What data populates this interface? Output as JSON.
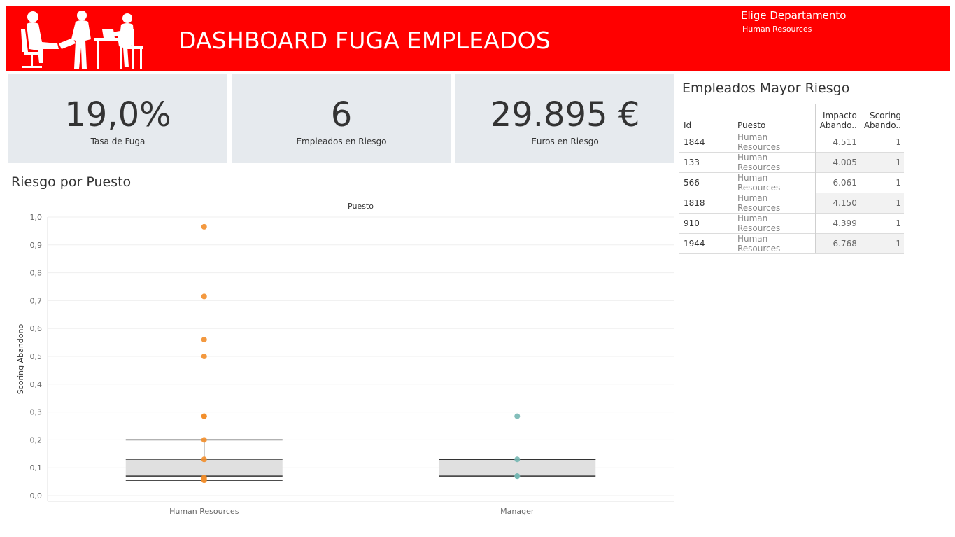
{
  "header": {
    "title": "DASHBOARD FUGA EMPLEADOS",
    "filter_label": "Elige Departamento",
    "filter_value": "Human Resources"
  },
  "kpis": [
    {
      "value": "19,0%",
      "label": "Tasa de Fuga"
    },
    {
      "value": "6",
      "label": "Empleados en Riesgo"
    },
    {
      "value": "29.895 €",
      "label": "Euros en Riesgo"
    }
  ],
  "risk_section": {
    "title": "Riesgo por Puesto"
  },
  "table_section": {
    "title": "Empleados Mayor Riesgo",
    "headers": [
      "Id",
      "Puesto",
      "Impacto Abando..",
      "Scoring Abando.."
    ],
    "rows": [
      [
        "1844",
        "Human Resources",
        "4.511",
        "1"
      ],
      [
        "133",
        "Human Resources",
        "4.005",
        "1"
      ],
      [
        "566",
        "Human Resources",
        "6.061",
        "1"
      ],
      [
        "1818",
        "Human Resources",
        "4.150",
        "1"
      ],
      [
        "910",
        "Human Resources",
        "4.399",
        "1"
      ],
      [
        "1944",
        "Human Resources",
        "6.768",
        "1"
      ]
    ]
  },
  "chart_data": {
    "type": "scatter",
    "title": "Puesto",
    "xlabel": "",
    "ylabel": "Scoring Abandono",
    "ylim": [
      0,
      1
    ],
    "yticks": [
      "0,0",
      "0,1",
      "0,2",
      "0,3",
      "0,4",
      "0,5",
      "0,6",
      "0,7",
      "0,8",
      "0,9",
      "1,0"
    ],
    "categories": [
      "Human Resources",
      "Manager"
    ],
    "grid": true,
    "colors": {
      "Human Resources": "#f28e2b",
      "Manager": "#76b7b2"
    },
    "series": [
      {
        "values": [
          0.965,
          0.715,
          0.56,
          0.5,
          0.285,
          0.285,
          0.2,
          0.13,
          0.065,
          0.06,
          0.055
        ]
      },
      {
        "values": [
          0.285,
          0.13,
          0.07,
          0.07
        ]
      }
    ],
    "boxplots": [
      {
        "q1": 0.07,
        "median": 0.055,
        "q3": 0.13,
        "whisker_low": 0.055,
        "whisker_high": 0.2
      },
      {
        "q1": 0.07,
        "median": 0.13,
        "q3": 0.13,
        "whisker_low": 0.07,
        "whisker_high": 0.13
      }
    ]
  }
}
